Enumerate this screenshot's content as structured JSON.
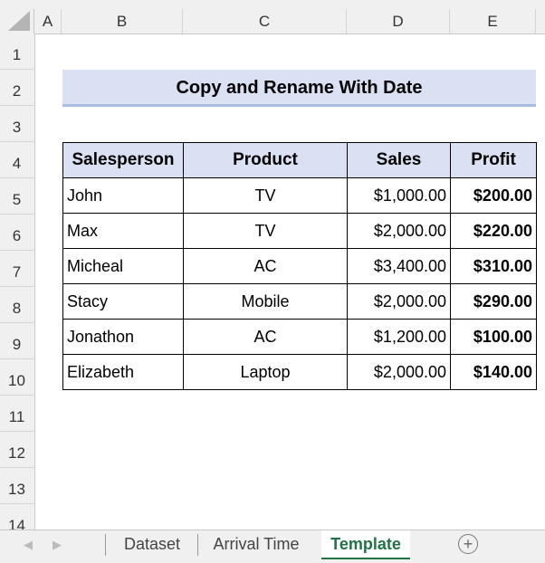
{
  "columns": [
    "A",
    "B",
    "C",
    "D",
    "E"
  ],
  "rows": [
    "1",
    "2",
    "3",
    "4",
    "5",
    "6",
    "7",
    "8",
    "9",
    "10",
    "11",
    "12",
    "13",
    "14"
  ],
  "title": "Copy and Rename With Date",
  "table": {
    "headers": [
      "Salesperson",
      "Product",
      "Sales",
      "Profit"
    ],
    "rows": [
      [
        "John",
        "TV",
        "$1,000.00",
        "$200.00"
      ],
      [
        "Max",
        "TV",
        "$2,000.00",
        "$220.00"
      ],
      [
        "Micheal",
        "AC",
        "$3,400.00",
        "$310.00"
      ],
      [
        "Stacy",
        "Mobile",
        "$2,000.00",
        "$290.00"
      ],
      [
        "Jonathon",
        "AC",
        "$1,200.00",
        "$100.00"
      ],
      [
        "Elizabeth",
        "Laptop",
        "$2,000.00",
        "$140.00"
      ]
    ]
  },
  "sheets": [
    "Dataset",
    "Arrival Time",
    "Template"
  ],
  "active_sheet": "Template",
  "add_sheet_icon": "+"
}
